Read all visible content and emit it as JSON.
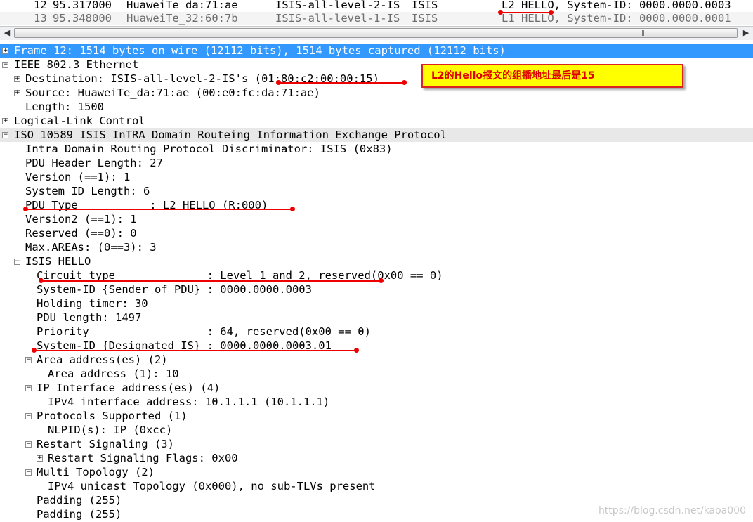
{
  "packet_list": [
    {
      "no": "12",
      "time": "95.317000",
      "source": "HuaweiTe_da:71:ae",
      "destination": "ISIS-all-level-2-IS",
      "protocol": "ISIS",
      "info": "L2 HELLO, System-ID: 0000.0000.0003"
    },
    {
      "no": "13",
      "time": "95.348000",
      "source": "HuaweiTe_32:60:7b",
      "destination": "ISIS-all-level-1-IS",
      "protocol": "ISIS",
      "info": "L1 HELLO, System-ID: 0000.0000.0001"
    }
  ],
  "scrollbar": {
    "left_arrow": "◀",
    "right_arrow": "▶",
    "grip": "|||"
  },
  "tree": {
    "frame": "Frame 12: 1514 bytes on wire (12112 bits), 1514 bytes captured (12112 bits)",
    "eth": "IEEE 802.3 Ethernet",
    "eth_dst": "Destination: ISIS-all-level-2-IS's (01:80:c2:00:00:15)",
    "eth_src": "Source: HuaweiTe_da:71:ae (00:e0:fc:da:71:ae)",
    "eth_len": "Length: 1500",
    "llc": "Logical-Link Control",
    "isis": "ISO 10589 ISIS InTRA Domain Routeing Information Exchange Protocol",
    "irpd": "Intra Domain Routing Protocol Discriminator: ISIS (0x83)",
    "hdr_len": "PDU Header Length: 27",
    "version": "Version (==1): 1",
    "sysid_len": "System ID Length: 6",
    "pdu_type": "PDU Type           : L2 HELLO (R:000)",
    "version2": "Version2 (==1): 1",
    "reserved": "Reserved (==0): 0",
    "max_areas": "Max.AREAs: (0==3): 3",
    "hello": "ISIS HELLO",
    "circuit": "Circuit type              : Level 1 and 2, reserved(0x00 == 0)",
    "sender": "System-ID {Sender of PDU} : 0000.0000.0003",
    "holding": "Holding timer: 30",
    "pdu_len": "PDU length: 1497",
    "priority": "Priority                  : 64, reserved(0x00 == 0)",
    "dis": "System-ID {Designated IS} : 0000.0000.0003.01",
    "area_hdr": "Area address(es) (2)",
    "area_val": "Area address (1): 10",
    "ip_hdr": "IP Interface address(es) (4)",
    "ip_val": "IPv4 interface address: 10.1.1.1 (10.1.1.1)",
    "proto_hdr": "Protocols Supported (1)",
    "proto_val": "NLPID(s): IP (0xcc)",
    "restart_hdr": "Restart Signaling (3)",
    "restart_val": "Restart Signaling Flags: 0x00",
    "mt_hdr": "Multi Topology (2)",
    "mt_val": "IPv4 unicast Topology (0x000), no sub-TLVs present",
    "padding1": "Padding (255)",
    "padding2": "Padding (255)"
  },
  "toggles": {
    "expand": "+",
    "collapse": "−"
  },
  "annotation": {
    "callout_text": "L2的Hello报文的组播地址最后是15"
  },
  "watermark": "https://blog.csdn.net/kaoa000",
  "colors": {
    "selected_row": "#3399ff",
    "annotation_red": "#e00000",
    "callout_bg": "#ffff00"
  }
}
